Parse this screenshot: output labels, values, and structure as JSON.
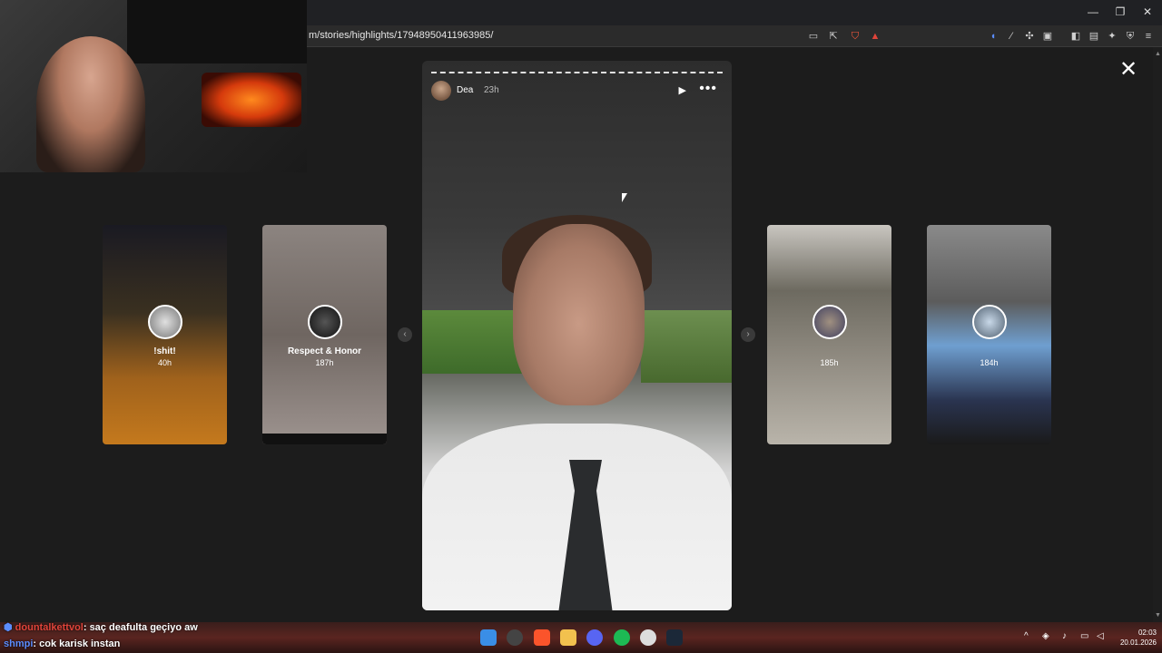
{
  "browser": {
    "url": "m/stories/highlights/17948950411963985/",
    "window_controls": {
      "minimize": "—",
      "restore": "❐",
      "close": "✕"
    }
  },
  "stories": {
    "close_label": "✕",
    "main": {
      "username": "Dea",
      "age": "23h",
      "play_icon": "▶",
      "more_icon": "•••"
    },
    "cards": [
      {
        "title": "!shit!",
        "time": "40h"
      },
      {
        "title": "Respect & Honor",
        "time": "187h"
      },
      {
        "title": "",
        "time": "185h"
      },
      {
        "title": "",
        "time": "184h"
      }
    ],
    "prev_arrow": "‹",
    "next_arrow": "›"
  },
  "chat": [
    {
      "user": "dountalkettvol",
      "message": ": saç deafulta geçiyo aw",
      "user_color": "#e0443a"
    },
    {
      "user": "shmpi",
      "message": ": cok karisk instan",
      "user_color": "#5b8dff"
    }
  ],
  "taskbar": {
    "clock_time": "02:03",
    "clock_date": "20.01.2026",
    "tray_chevron": "^"
  },
  "colors": {
    "accent_blue": "#1e90ff"
  }
}
